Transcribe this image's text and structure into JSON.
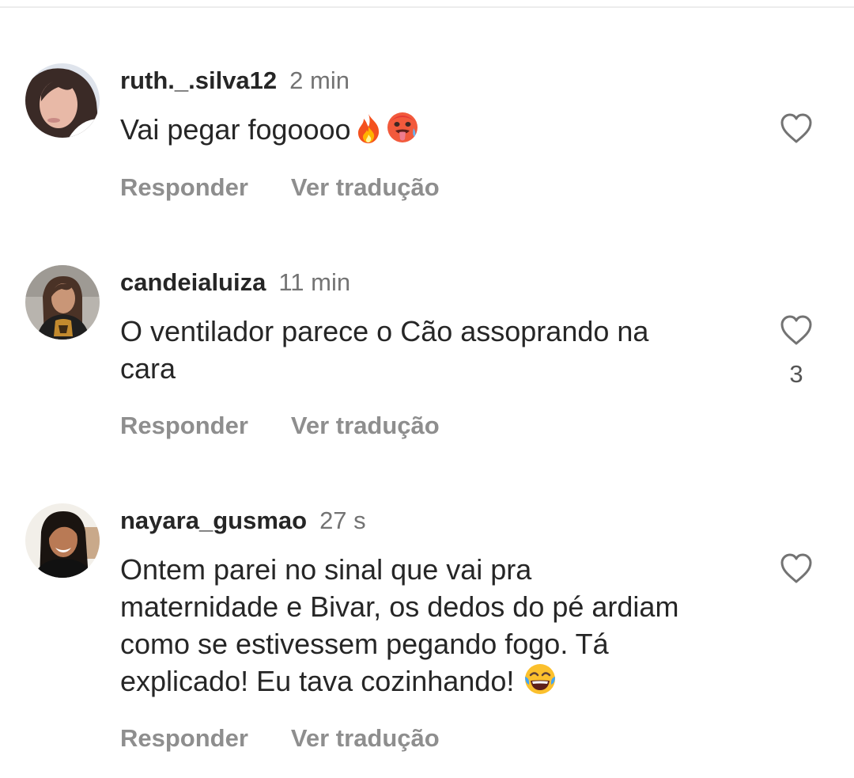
{
  "comments": [
    {
      "username": "ruth._.silva12",
      "time": "2 min",
      "lines": [
        "Vai pegar fogoooo"
      ],
      "emojis": [
        "fire-emoji",
        "hot-face-emoji"
      ],
      "like_count": "",
      "reply_label": "Responder",
      "translate_label": "Ver tradução"
    },
    {
      "username": "candeialuiza",
      "time": "11 min",
      "lines": [
        "O ventilador parece o Cão assoprando na",
        "cara"
      ],
      "emojis": [],
      "like_count": "3",
      "reply_label": "Responder",
      "translate_label": "Ver tradução"
    },
    {
      "username": "nayara_gusmao",
      "time": "27 s",
      "lines": [
        "Ontem parei no sinal que vai pra",
        "maternidade e Bivar, os dedos do pé ardiam",
        "como se estivessem pegando fogo. Tá",
        "explicado! Eu tava cozinhando!"
      ],
      "emojis": [
        "tears-of-joy-emoji"
      ],
      "like_count": "",
      "reply_label": "Responder",
      "translate_label": "Ver tradução"
    }
  ],
  "colors": {
    "text": "#262626",
    "secondary": "#737373",
    "action": "#8e8e8e",
    "background": "#ffffff"
  },
  "icons": {
    "like": "heart-outline-icon"
  }
}
